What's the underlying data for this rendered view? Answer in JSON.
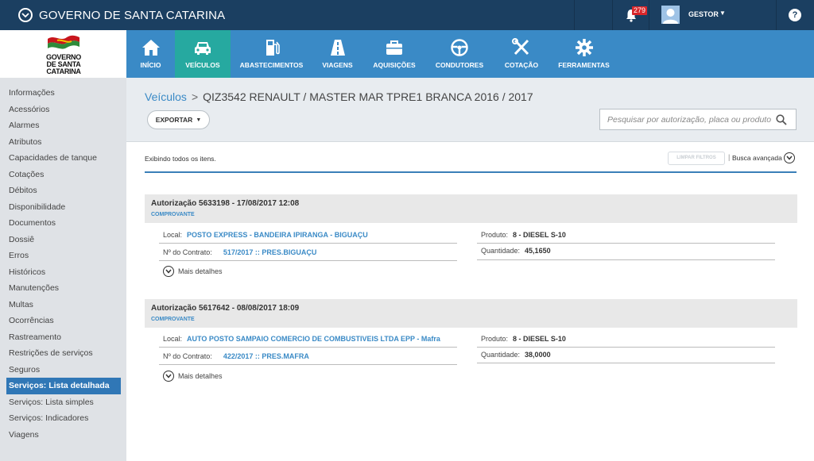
{
  "topbar": {
    "title": "GOVERNO DE SANTA CATARINA",
    "notification_count": "279",
    "user_name": "GESTOR",
    "help_label": "?"
  },
  "logo": {
    "line1": "GOVERNO",
    "line2": "DE SANTA",
    "line3": "CATARINA"
  },
  "nav": {
    "items": [
      {
        "label": "INÍCIO",
        "icon": "home-icon"
      },
      {
        "label": "VEÍCULOS",
        "icon": "car-icon",
        "active": true
      },
      {
        "label": "ABASTECIMENTOS",
        "icon": "fuel-pump-icon"
      },
      {
        "label": "VIAGENS",
        "icon": "road-icon"
      },
      {
        "label": "AQUISIÇÕES",
        "icon": "briefcase-icon"
      },
      {
        "label": "CONDUTORES",
        "icon": "steering-wheel-icon"
      },
      {
        "label": "COTAÇÃO",
        "icon": "tools-icon"
      },
      {
        "label": "FERRAMENTAS",
        "icon": "gear-icon"
      }
    ]
  },
  "sidebar": {
    "items": [
      {
        "label": "Informações"
      },
      {
        "label": "Acessórios"
      },
      {
        "label": "Alarmes"
      },
      {
        "label": "Atributos"
      },
      {
        "label": "Capacidades de tanque"
      },
      {
        "label": "Cotações"
      },
      {
        "label": "Débitos"
      },
      {
        "label": "Disponibilidade"
      },
      {
        "label": "Documentos"
      },
      {
        "label": "Dossiê"
      },
      {
        "label": "Erros"
      },
      {
        "label": "Históricos"
      },
      {
        "label": "Manutenções"
      },
      {
        "label": "Multas"
      },
      {
        "label": "Ocorrências"
      },
      {
        "label": "Rastreamento"
      },
      {
        "label": "Restrições de serviços"
      },
      {
        "label": "Seguros"
      },
      {
        "label": "Serviços: Lista detalhada",
        "active": true
      },
      {
        "label": "Serviços: Lista simples"
      },
      {
        "label": "Serviços: Indicadores"
      },
      {
        "label": "Viagens"
      }
    ]
  },
  "breadcrumb": {
    "parent": "Veículos",
    "separator": ">",
    "current": "QIZ3542 RENAULT / MASTER MAR TPRE1 BRANCA 2016 / 2017"
  },
  "toolbar": {
    "export_label": "EXPORTAR"
  },
  "search": {
    "placeholder": "Pesquisar por autorização, placa ou produto",
    "value": ""
  },
  "filters": {
    "showing_text": "Exibindo todos os itens.",
    "clear_label": "LIMPAR FILTROS",
    "separator": "|",
    "advanced_label": "Busca avançada"
  },
  "records": [
    {
      "title": "Autorização 5633198 - 17/08/2017 12:08",
      "subtitle": "COMPROVANTE",
      "local_label": "Local:",
      "local_value": "POSTO EXPRESS - BANDEIRA IPIRANGA - BIGUAÇU",
      "contract_label": "Nº do Contrato:",
      "contract_value": "517/2017 :: PRES.BIGUAÇU",
      "product_label": "Produto:",
      "product_value": "8 - DIESEL S-10",
      "qty_label": "Quantidade:",
      "qty_value": "45,1650",
      "more_label": "Mais detalhes"
    },
    {
      "title": "Autorização 5617642 - 08/08/2017 18:09",
      "subtitle": "COMPROVANTE",
      "local_label": "Local:",
      "local_value": "AUTO POSTO SAMPAIO COMERCIO DE COMBUSTIVEIS LTDA EPP - Mafra",
      "contract_label": "Nº do Contrato:",
      "contract_value": "422/2017 :: PRES.MAFRA",
      "product_label": "Produto:",
      "product_value": "8 - DIESEL S-10",
      "qty_label": "Quantidade:",
      "qty_value": "38,0000",
      "more_label": "Mais detalhes"
    }
  ],
  "colors": {
    "topbar": "#1b3f61",
    "nav": "#3a8ac6",
    "nav_active": "#26a9a0",
    "sidebar": "#dfe2e6",
    "sidebar_active": "#3077b6",
    "notification": "#d9262a"
  }
}
